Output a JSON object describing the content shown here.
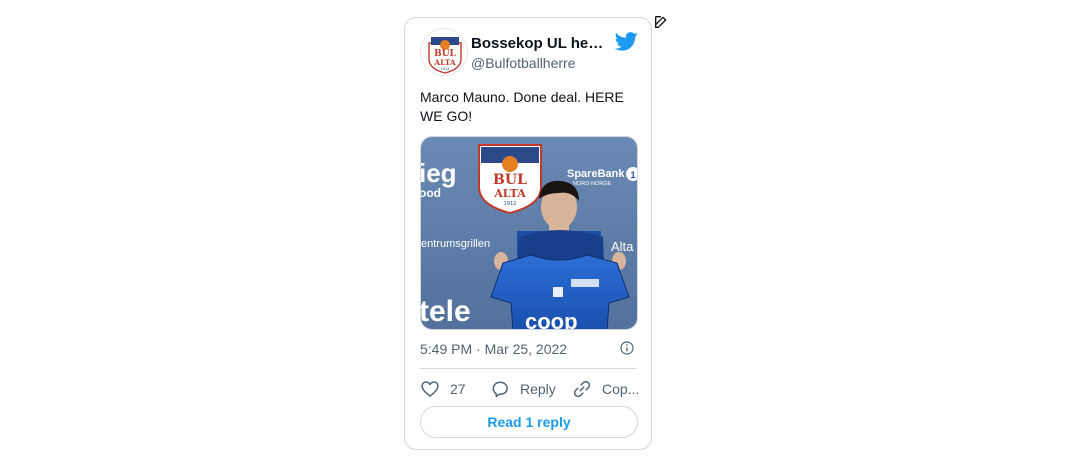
{
  "author": {
    "display_name": "Bossekop UL herr...",
    "handle": "@Bulfotballherre",
    "logo_text_top": "BUL",
    "logo_text_bottom": "ALTA",
    "logo_year": "1912"
  },
  "tweet": {
    "text": "Marco Mauno. Done deal. HERE WE GO!",
    "timestamp": "5:49 PM · Mar 25, 2022"
  },
  "media_signage": {
    "left_top": "ieg",
    "left_sub": "ood",
    "crest_top": "BUL",
    "crest_bottom": "ALTA",
    "crest_year": "1912",
    "sparebank": "SpareBank",
    "sparebank_sub": "NORD-NORGE",
    "sparebank_num": "1",
    "sentrum": "entrumsgrillen",
    "altaa": "Alta",
    "tele": "tele",
    "coop": "coop"
  },
  "actions": {
    "like_count": "27",
    "reply_label": "Reply",
    "copy_label": "Cop..."
  },
  "read_reply_label": "Read 1 reply",
  "colors": {
    "accent": "#1d9bf0",
    "muted": "#536471",
    "border": "#cfd9de",
    "jersey_blue": "#1f5fc8"
  },
  "icons": [
    "edit-icon",
    "twitter-bird-icon",
    "info-icon",
    "heart-icon",
    "reply-icon",
    "link-icon"
  ]
}
